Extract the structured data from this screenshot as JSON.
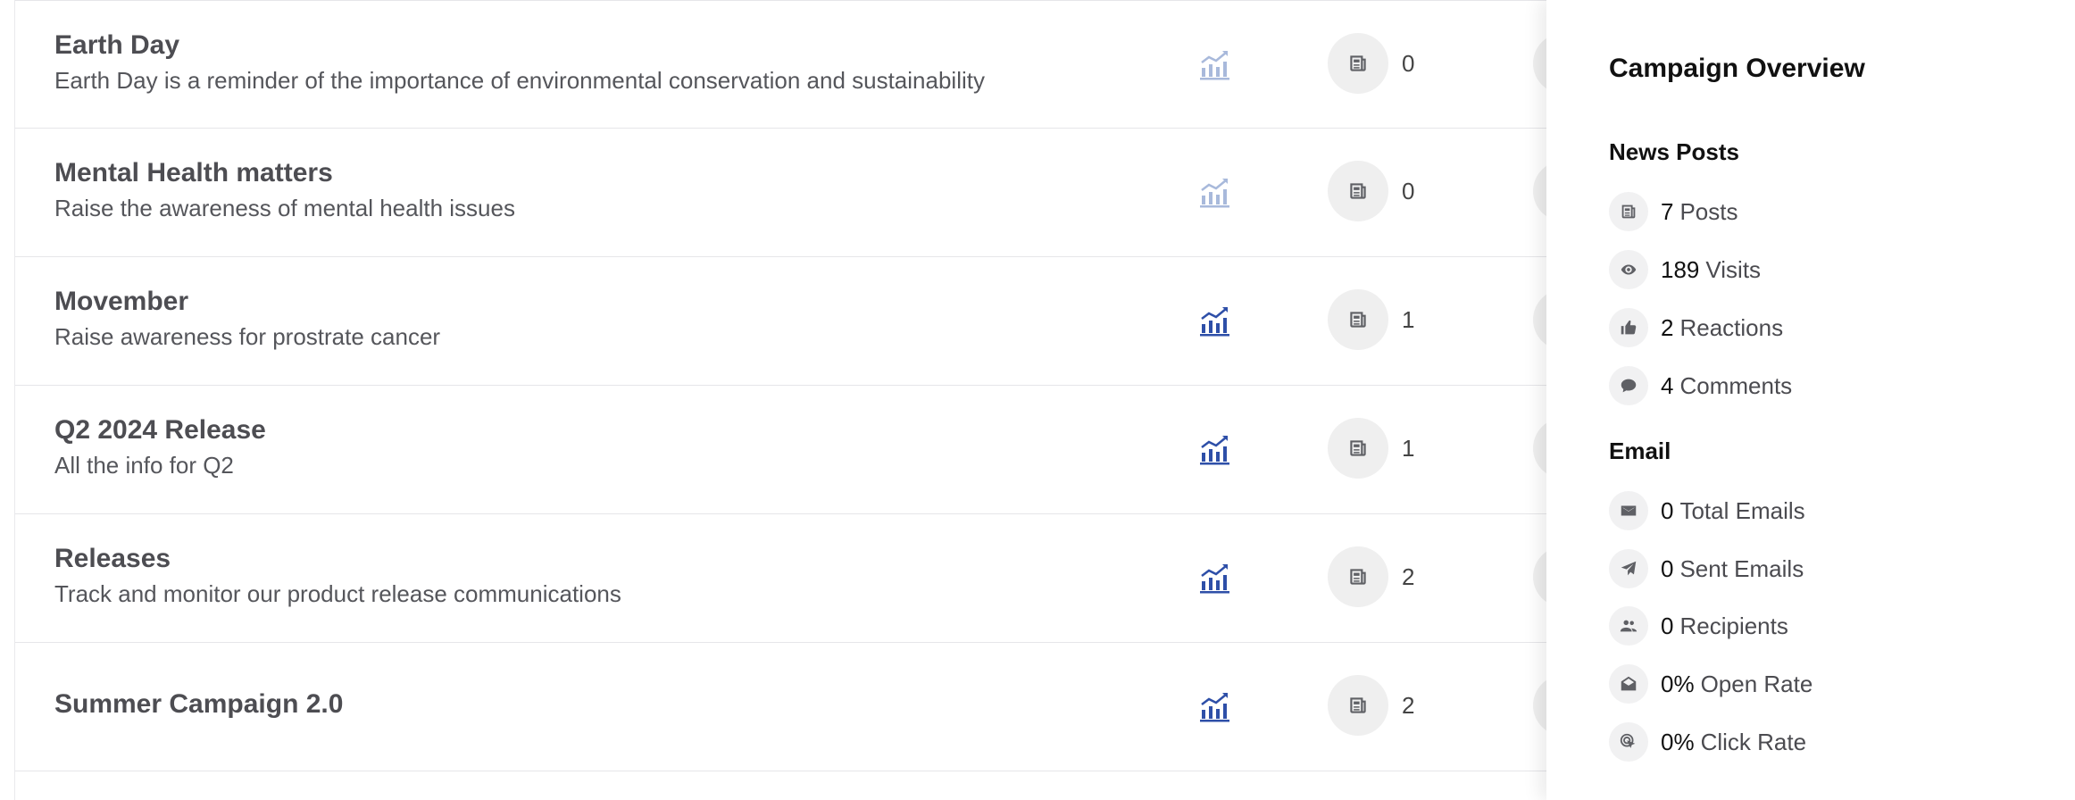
{
  "campaigns": [
    {
      "title": "Earth Day",
      "description": "Earth Day is a reminder of the importance of environmental conservation and sustainability",
      "posts": "0",
      "analytics_enabled": false
    },
    {
      "title": "Mental Health matters",
      "description": "Raise the awareness of mental health issues",
      "posts": "0",
      "analytics_enabled": false
    },
    {
      "title": "Movember",
      "description": "Raise awareness for prostrate cancer",
      "posts": "1",
      "analytics_enabled": true
    },
    {
      "title": "Q2 2024 Release",
      "description": "All the info for Q2",
      "posts": "1",
      "analytics_enabled": true
    },
    {
      "title": "Releases",
      "description": "Track and monitor our product release communications",
      "posts": "2",
      "analytics_enabled": true
    },
    {
      "title": "Summer Campaign 2.0",
      "description": "",
      "posts": "2",
      "analytics_enabled": true
    }
  ],
  "overview": {
    "title": "Campaign Overview",
    "news_posts": {
      "heading": "News Posts",
      "stats": [
        {
          "value": "7",
          "label": "Posts",
          "icon": "newspaper-icon"
        },
        {
          "value": "189",
          "label": "Visits",
          "icon": "eye-icon"
        },
        {
          "value": "2",
          "label": "Reactions",
          "icon": "thumbs-up-icon"
        },
        {
          "value": "4",
          "label": "Comments",
          "icon": "comment-icon"
        }
      ]
    },
    "email": {
      "heading": "Email",
      "stats": [
        {
          "value": "0",
          "label": "Total Emails",
          "icon": "envelope-icon"
        },
        {
          "value": "0",
          "label": "Sent Emails",
          "icon": "paper-plane-icon"
        },
        {
          "value": "0",
          "label": "Recipients",
          "icon": "users-icon"
        },
        {
          "value": "0%",
          "label": "Open Rate",
          "icon": "envelope-open-icon"
        },
        {
          "value": "0%",
          "label": "Click Rate",
          "icon": "click-pointer-icon"
        }
      ]
    }
  },
  "colors": {
    "analytics_active": "#2e4fa8",
    "analytics_inactive": "#a8b9db",
    "icon_gray": "#5f6065"
  }
}
